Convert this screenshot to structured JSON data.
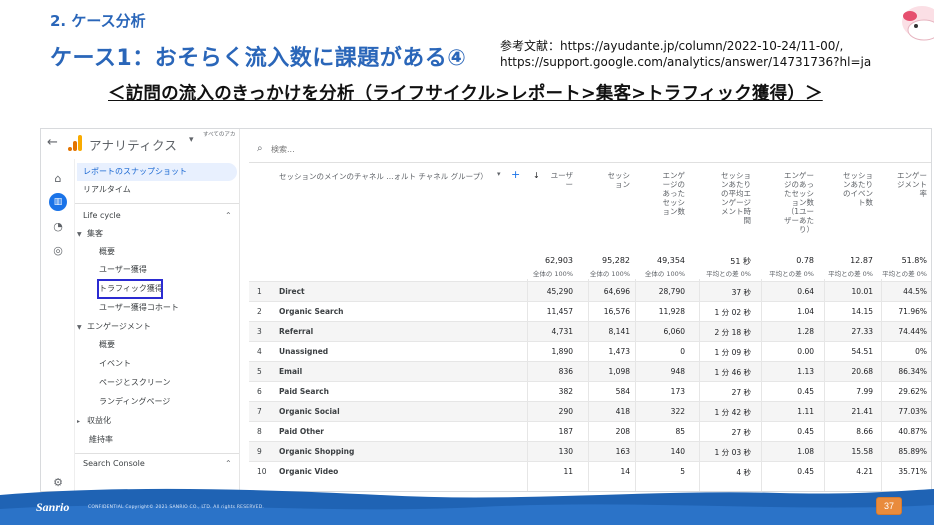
{
  "slide": {
    "section_title": "2. ケース分析",
    "case_title": "ケース1：おそらく流入数に課題がある④",
    "reference_line1": "参考文献：https://ayudante.jp/column/2022-10-24/11-00/,",
    "reference_line2": "https://support.google.com/analytics/answer/14731736?hl=ja",
    "subtitle": "＜訪問の流入のきっかけを分析（ライフサイクル>レポート>集客>トラフィック獲得）＞",
    "footer_logo": "Sanrio",
    "footer_copyright": "CONFIDENTIAL Copyright© 2021 SANRIO CO., LTD. All rights RESERVED.",
    "page_number": "37",
    "colors": {
      "title_blue": "#2a66b9",
      "footer_blue": "#1f63b4",
      "page_badge": "#e98b3c"
    }
  },
  "ga": {
    "app_title": "アナリティクス",
    "account_line": "すべてのアカ",
    "rail_icons": [
      "home-icon",
      "reports-icon",
      "explore-icon",
      "advertising-icon",
      "settings-icon"
    ],
    "nav": {
      "snapshot": "レポートのスナップショット",
      "realtime": "リアルタイム",
      "lifecycle": "Life cycle",
      "acquisition": "集客",
      "acq_overview": "概要",
      "user_acquisition": "ユーザー獲得",
      "traffic_acquisition": "トラフィック獲得",
      "user_cohort": "ユーザー獲得コホート",
      "engagement": "エンゲージメント",
      "eng_overview": "概要",
      "events": "イベント",
      "pages_screens": "ページとスクリーン",
      "landing_page": "ランディングページ",
      "monetization": "収益化",
      "retention": "維持率",
      "search_console": "Search Console"
    },
    "search_placeholder": "検索...",
    "table": {
      "dimension_header": "セッションのメインのチャネル ...ォルト チャネル グループ）",
      "metric_headers": [
        "ユーザー",
        "セッション",
        "エンゲージのあったセッション数",
        "セッションあたりの平均エンゲージメント時間",
        "エンゲージのあったセッション数（1ユーザーあたり）",
        "セッションあたりのイベント数",
        "エンゲージメント率"
      ],
      "metric_headers_lines": [
        [
          "ユーザ",
          "ー"
        ],
        [
          "セッシ",
          "ョン"
        ],
        [
          "エンゲ",
          "ージの",
          "あった",
          "セッシ",
          "ョン数"
        ],
        [
          "セッショ",
          "ンあたり",
          "の平均エ",
          "ンゲージ",
          "メント時",
          "間"
        ],
        [
          "エンゲー",
          "ジのあっ",
          "たセッシ",
          "ョン数",
          "（1ユー",
          "ザーあた",
          "り）"
        ],
        [
          "セッショ",
          "ンあたり",
          "のイベン",
          "ト数"
        ],
        [
          "エンゲー",
          "ジメント",
          "率"
        ]
      ],
      "totals": [
        "62,903",
        "95,282",
        "49,354",
        "51 秒",
        "0.78",
        "12.87",
        "51.8%"
      ],
      "totals_sub": [
        "全体の 100%",
        "全体の 100%",
        "全体の 100%",
        "平均との差 0%",
        "平均との差 0%",
        "平均との差 0%",
        "平均との差 0%"
      ],
      "rows": [
        {
          "idx": "1",
          "name": "Direct",
          "vals": [
            "45,290",
            "64,696",
            "28,790",
            "37 秒",
            "0.64",
            "10.01",
            "44.5%"
          ]
        },
        {
          "idx": "2",
          "name": "Organic Search",
          "vals": [
            "11,457",
            "16,576",
            "11,928",
            "1 分 02 秒",
            "1.04",
            "14.15",
            "71.96%"
          ]
        },
        {
          "idx": "3",
          "name": "Referral",
          "vals": [
            "4,731",
            "8,141",
            "6,060",
            "2 分 18 秒",
            "1.28",
            "27.33",
            "74.44%"
          ]
        },
        {
          "idx": "4",
          "name": "Unassigned",
          "vals": [
            "1,890",
            "1,473",
            "0",
            "1 分 09 秒",
            "0.00",
            "54.51",
            "0%"
          ]
        },
        {
          "idx": "5",
          "name": "Email",
          "vals": [
            "836",
            "1,098",
            "948",
            "1 分 46 秒",
            "1.13",
            "20.68",
            "86.34%"
          ]
        },
        {
          "idx": "6",
          "name": "Paid Search",
          "vals": [
            "382",
            "584",
            "173",
            "27 秒",
            "0.45",
            "7.99",
            "29.62%"
          ]
        },
        {
          "idx": "7",
          "name": "Organic Social",
          "vals": [
            "290",
            "418",
            "322",
            "1 分 42 秒",
            "1.11",
            "21.41",
            "77.03%"
          ]
        },
        {
          "idx": "8",
          "name": "Paid Other",
          "vals": [
            "187",
            "208",
            "85",
            "27 秒",
            "0.45",
            "8.66",
            "40.87%"
          ]
        },
        {
          "idx": "9",
          "name": "Organic Shopping",
          "vals": [
            "130",
            "163",
            "140",
            "1 分 03 秒",
            "1.08",
            "15.58",
            "85.89%"
          ]
        },
        {
          "idx": "10",
          "name": "Organic Video",
          "vals": [
            "11",
            "14",
            "5",
            "4 秒",
            "0.45",
            "4.21",
            "35.71%"
          ]
        }
      ]
    }
  }
}
